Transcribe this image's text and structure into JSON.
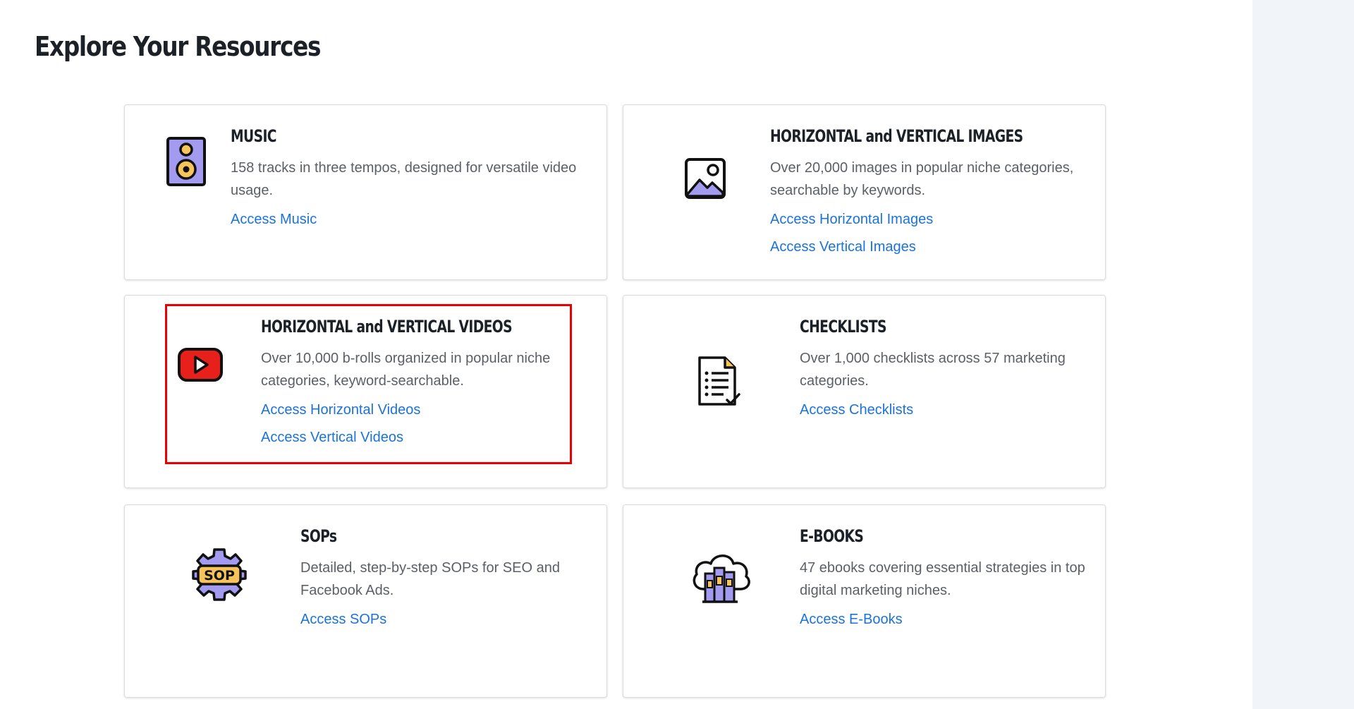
{
  "page": {
    "title": "Explore Your Resources"
  },
  "cards": [
    {
      "title": "MUSIC",
      "description": "158 tracks in three tempos, designed for versatile video usage.",
      "icon": "speaker-icon",
      "links": [
        "Access Music"
      ]
    },
    {
      "title": "HORIZONTAL and VERTICAL IMAGES",
      "description": "Over 20,000 images in popular niche categories, searchable by keywords.",
      "icon": "image-icon",
      "links": [
        "Access Horizontal Images",
        "Access Vertical Images"
      ]
    },
    {
      "title": "HORIZONTAL and VERTICAL VIDEOS",
      "description": "Over 10,000 b-rolls organized in popular niche categories, keyword-searchable.",
      "icon": "youtube-play-icon",
      "links": [
        "Access Horizontal Videos",
        "Access Vertical Videos"
      ]
    },
    {
      "title": "CHECKLISTS",
      "description": "Over 1,000 checklists across 57 marketing categories.",
      "icon": "checklist-icon",
      "links": [
        "Access Checklists"
      ]
    },
    {
      "title": "SOPs",
      "description": "Detailed, step-by-step SOPs for SEO and Facebook Ads.",
      "icon": "sop-gear-icon",
      "links": [
        "Access SOPs"
      ]
    },
    {
      "title": "E-BOOKS",
      "description": "47 ebooks covering essential strategies in top digital marketing niches.",
      "icon": "cloud-books-icon",
      "links": [
        "Access E-Books"
      ]
    }
  ],
  "colors": {
    "link": "#1a73d9",
    "heading": "#1c2128",
    "text": "#5b5f66",
    "highlight": "#ea0000",
    "icon_purple": "#a39bf0",
    "icon_yellow": "#f7c45b",
    "youtube_red": "#e8201c"
  }
}
